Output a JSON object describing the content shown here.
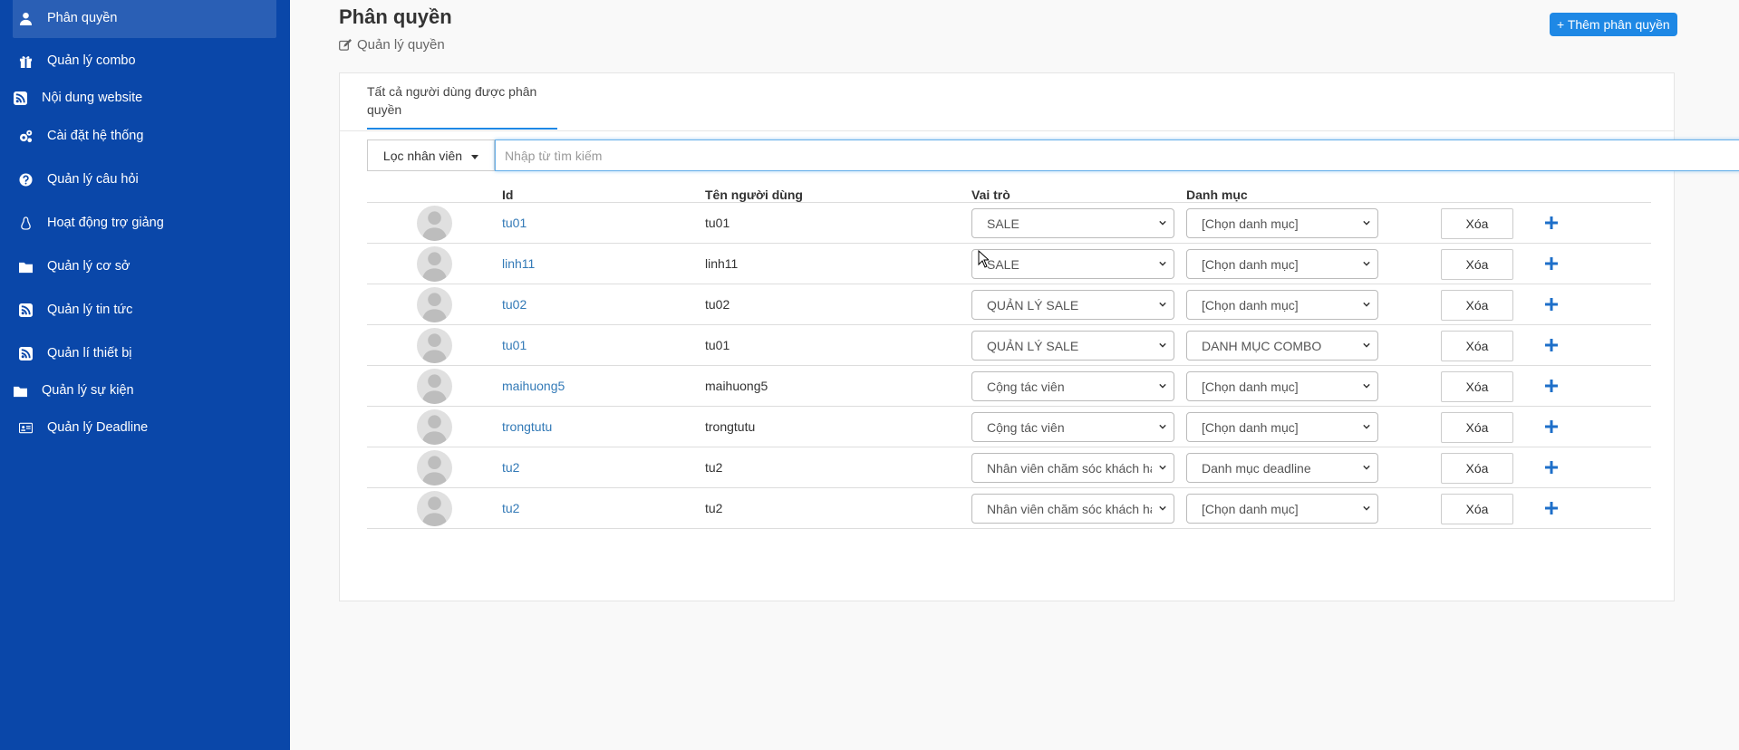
{
  "sidebar": {
    "items": [
      {
        "label": "Phân quyền",
        "icon": "user-icon",
        "active": true
      },
      {
        "label": "Quản lý combo",
        "icon": "gift-icon"
      },
      {
        "label": "Nội dung website",
        "icon": "rss-icon"
      },
      {
        "label": "Cài đặt hệ thống",
        "icon": "gears-icon"
      },
      {
        "label": "Quản lý câu hỏi",
        "icon": "question-circle-icon"
      },
      {
        "label": "Hoạt động trợ giảng",
        "icon": "linux-icon"
      },
      {
        "label": "Quản lý cơ sở",
        "icon": "folder-icon"
      },
      {
        "label": "Quản lý tin tức",
        "icon": "rss-icon"
      },
      {
        "label": "Quản lí thiết bị",
        "icon": "rss-icon"
      },
      {
        "label": "Quản lý sự kiện",
        "icon": "folder-icon"
      },
      {
        "label": "Quản lý Deadline",
        "icon": "id-card-icon"
      }
    ]
  },
  "header": {
    "title": "Phân quyền",
    "subtitle": "Quản lý quyền",
    "add_button": "+ Thêm phân quyền"
  },
  "tabs": [
    {
      "label": "Tất cả người dùng được phân quyền",
      "active": true
    }
  ],
  "filter": {
    "dropdown_label": "Lọc nhân viên",
    "search_placeholder": "Nhập từ tìm kiếm",
    "search_value": ""
  },
  "table": {
    "columns": [
      "Id",
      "Tên người dùng",
      "Vai trò",
      "Danh mục"
    ],
    "delete_label": "Xóa",
    "rows": [
      {
        "id": "tu01",
        "name": "tu01",
        "role": "SALE",
        "category": "[Chọn danh mục]"
      },
      {
        "id": "linh11",
        "name": "linh11",
        "role": "SALE",
        "category": "[Chọn danh mục]"
      },
      {
        "id": "tu02",
        "name": "tu02",
        "role": "QUẢN LÝ SALE",
        "category": "[Chọn danh mục]"
      },
      {
        "id": "tu01",
        "name": "tu01",
        "role": "QUẢN LÝ SALE",
        "category": "DANH MỤC COMBO"
      },
      {
        "id": "maihuong5",
        "name": "maihuong5",
        "role": "Cộng tác viên",
        "category": "[Chọn danh mục]"
      },
      {
        "id": "trongtutu",
        "name": "trongtutu",
        "role": "Cộng tác viên",
        "category": "[Chọn danh mục]"
      },
      {
        "id": "tu2",
        "name": "tu2",
        "role": "Nhân viên chăm sóc khách hàng",
        "category": "Danh mục deadline"
      },
      {
        "id": "tu2",
        "name": "tu2",
        "role": "Nhân viên chăm sóc khách hàng",
        "category": "[Chọn danh mục]"
      }
    ]
  },
  "colors": {
    "sidebar_bg": "#0a47a9",
    "sidebar_active": "#2a5fb5",
    "accent": "#1e88e5",
    "link": "#337ab7"
  }
}
